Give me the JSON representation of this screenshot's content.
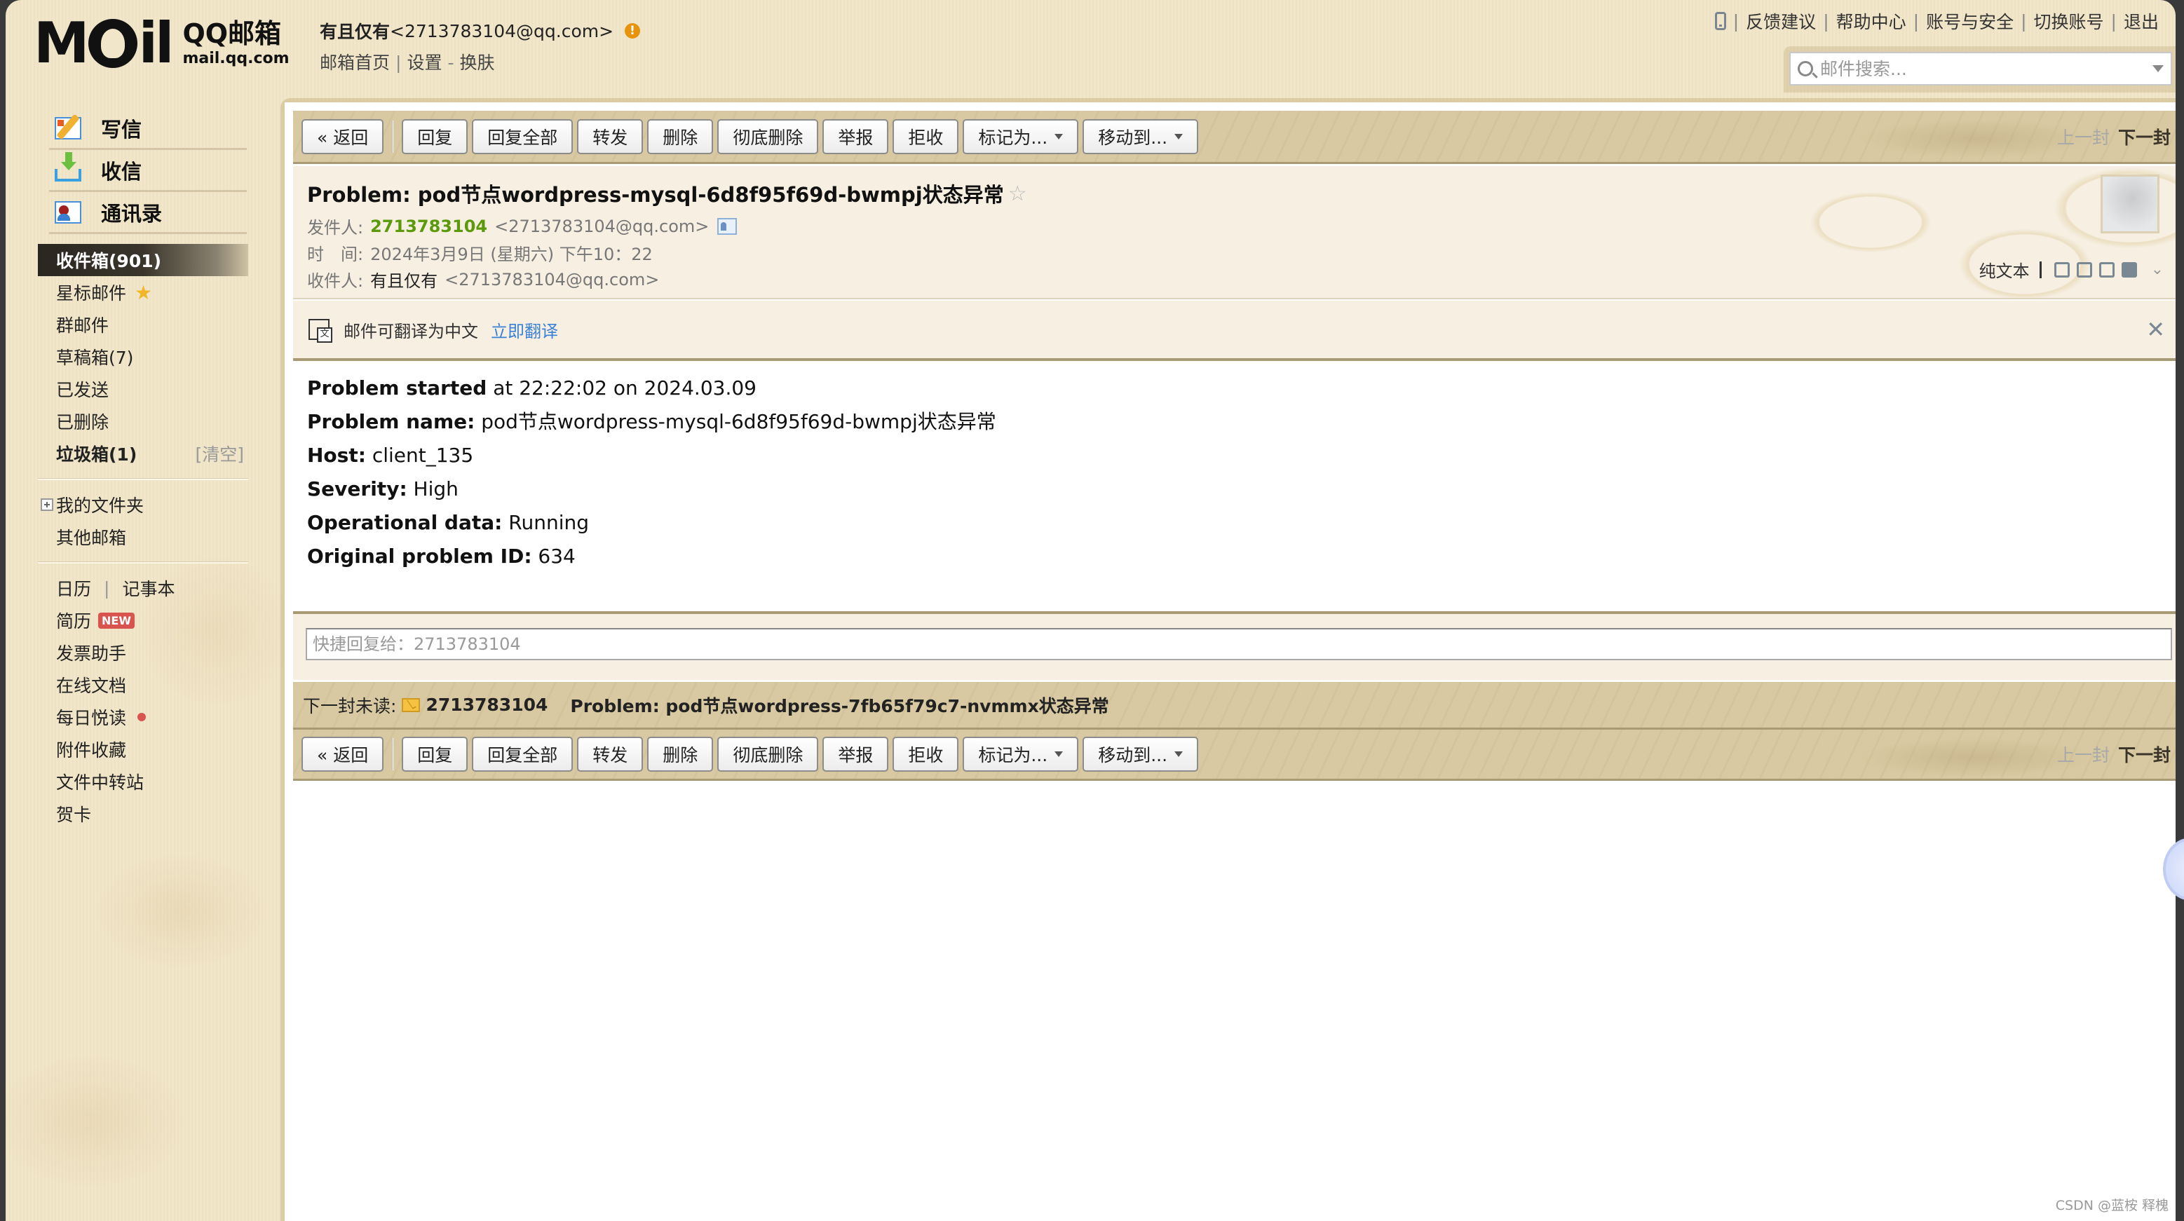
{
  "header": {
    "logo_mail": "M",
    "logo_tail": "il",
    "logo_brand": "QQ邮箱",
    "logo_domain": "mail.qq.com",
    "user_name": "有且仅有",
    "user_email": "<2713783104@qq.com>",
    "warn_icon": "!",
    "links": [
      "邮箱首页",
      "设置",
      "换肤"
    ],
    "top_links": [
      "反馈建议",
      "帮助中心",
      "账号与安全",
      "切换账号",
      "退出"
    ],
    "search_placeholder": "邮件搜索..."
  },
  "sidebar": {
    "main_items": [
      {
        "label": "写信",
        "icon": "compose-icon"
      },
      {
        "label": "收信",
        "icon": "inbox-download-icon"
      },
      {
        "label": "通讯录",
        "icon": "contacts-icon"
      }
    ],
    "folders": [
      {
        "label": "收件箱(901)",
        "active": true
      },
      {
        "label": "星标邮件"
      },
      {
        "label": "群邮件"
      },
      {
        "label": "草稿箱(7)"
      },
      {
        "label": "已发送"
      },
      {
        "label": "已删除"
      },
      {
        "label": "垃圾箱(1)",
        "bold": true,
        "action": "[清空]"
      }
    ],
    "my_folders": "我的文件夹",
    "other_mailbox": "其他邮箱",
    "apps": {
      "calendar": "日历",
      "notes": "记事本",
      "resume": "简历",
      "resume_badge": "NEW",
      "invoice": "发票助手",
      "docs": "在线文档",
      "daily_read": "每日悦读",
      "attachments": "附件收藏",
      "file_transfer": "文件中转站",
      "greeting_card": "贺卡"
    }
  },
  "toolbar": {
    "back": "« 返回",
    "buttons": [
      "回复",
      "回复全部",
      "转发",
      "删除",
      "彻底删除",
      "举报",
      "拒收"
    ],
    "mark_as": "标记为...",
    "move_to": "移动到...",
    "prev": "上一封",
    "next": "下一封"
  },
  "mail": {
    "subject": "Problem: pod节点wordpress-mysql-6d8f95f69d-bwmpj状态异常",
    "from_label": "发件人:",
    "from_name": "2713783104",
    "from_email": "<2713783104@qq.com>",
    "time_label": "时　间:",
    "time_value": "2024年3月9日 (星期六) 下午10：22",
    "to_label": "收件人:",
    "to_name": "有且仅有",
    "to_email": "<2713783104@qq.com>",
    "plain_text": "纯文本",
    "translate_text": "邮件可翻译为中文",
    "translate_link": "立即翻译",
    "body": [
      {
        "key": "Problem started",
        "value": " at 22:22:02 on 2024.03.09"
      },
      {
        "key": "Problem name:",
        "value": " pod节点wordpress-mysql-6d8f95f69d-bwmpj状态异常"
      },
      {
        "key": "Host:",
        "value": " client_135"
      },
      {
        "key": "Severity:",
        "value": " High"
      },
      {
        "key": "Operational data:",
        "value": " Running"
      },
      {
        "key": "Original problem ID:",
        "value": " 634"
      }
    ],
    "quick_reply_placeholder": "快捷回复给：2713783104"
  },
  "next_unread": {
    "label": "下一封未读:",
    "sender": "2713783104",
    "subject": "Problem: pod节点wordpress-7fb65f79c7-nvmmx状态异常"
  },
  "watermark": "CSDN @蓝桉 释槐",
  "colors": {
    "sender_green": "#5c9a0c",
    "link_blue": "#3a82d8",
    "badge_red": "#d9534f",
    "star_gold": "#f0b628"
  }
}
